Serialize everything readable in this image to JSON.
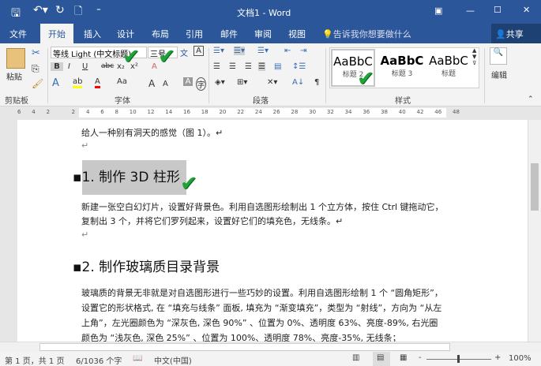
{
  "title": "文档1 - Word",
  "quick_access": {
    "save": "save-icon",
    "undo": "undo-icon",
    "redo": "redo-icon",
    "preview": "print-preview-icon"
  },
  "window": {
    "ribbon_display": "▣",
    "minimize": "—",
    "maximize": "☐",
    "close": "✕"
  },
  "tabs": [
    "文件",
    "开始",
    "插入",
    "设计",
    "布局",
    "引用",
    "邮件",
    "审阅",
    "视图"
  ],
  "tell_me": "告诉我你想要做什么",
  "share": "共享",
  "clipboard": {
    "paste": "粘贴",
    "label": "剪贴板"
  },
  "font": {
    "name": "等线 Light (中文标题)",
    "size": "三号",
    "label": "字体",
    "bold": "B",
    "italic": "I",
    "underline": "U",
    "strike": "abc",
    "sub": "x₂",
    "sup": "x²",
    "case": "Aa",
    "grow": "A",
    "shrink": "A"
  },
  "paragraph": {
    "label": "段落"
  },
  "styles": {
    "label": "样式",
    "items": [
      {
        "preview": "AaBbC",
        "name": "标题 2"
      },
      {
        "preview": "AaBbC",
        "name": "标题 3"
      },
      {
        "preview": "AaBbC",
        "name": "标题"
      }
    ]
  },
  "editing": {
    "label": "编辑"
  },
  "ruler_ticks": [
    "6",
    "4",
    "2",
    "",
    "2",
    "4",
    "6",
    "8",
    "10",
    "12",
    "14",
    "16",
    "18",
    "20",
    "22",
    "24",
    "26",
    "28",
    "30",
    "32",
    "34",
    "36",
    "38",
    "40",
    "42",
    "46",
    "48"
  ],
  "document": {
    "line0": "给人一种别有洞天的感觉（图 1）。↵",
    "h1": "1. 制作 3D 柱形",
    "p1": "新建一张空白幻灯片，设置好背景色。利用自选图形绘制出 1 个立方体，按住 Ctrl 键拖动它，复制出 3 个，并将它们罗列起来，设置好它们的填充色，无线条。↵",
    "h2": "2. 制作玻璃质目录背景",
    "p2": "玻璃质的背景无非就是对自选图形进行一些巧妙的设置。利用自选图形绘制 1 个 “圆角矩形”，设置它的形状格式, 在 “填充与线条” 面板, 填充为 “渐变填充”，类型为 “射线”，方向为 “从左上角”，左光圈颜色为 “深灰色, 深色 90%” 、位置为 0%、透明度 63%、亮度-89%, 右光圈颜色为 “浅灰色, 深色 25%” 、位置为 100%、透明度 78%、亮度-35%, 无线条；"
  },
  "status": {
    "page": "第 1 页，共 1 页",
    "words": "6/1036 个字",
    "language": "中文(中国)",
    "zoom": "100%",
    "zoom_level": 100
  },
  "colors": {
    "brand": "#2b579a",
    "check": "#22a33a",
    "highlight": "#ffff00",
    "font_color": "#ff0000"
  }
}
